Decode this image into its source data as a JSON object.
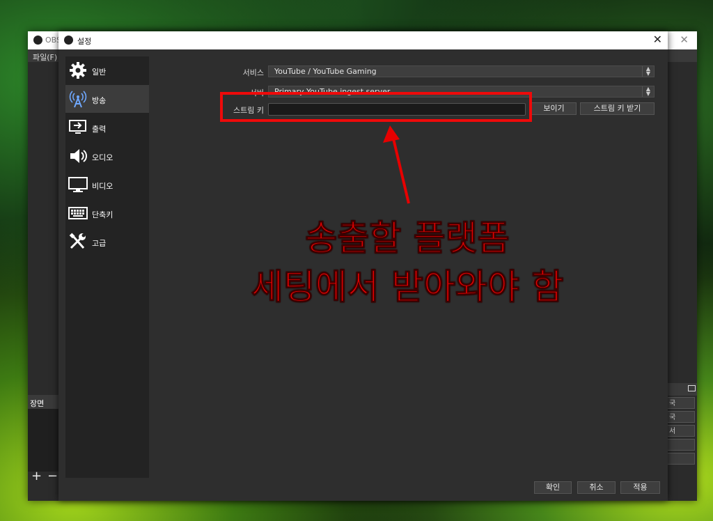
{
  "main_window": {
    "title": "OBS",
    "menu_file": "파일(F)",
    "scenes_label": "장면",
    "add_symbol": "+",
    "remove_symbol": "−",
    "dock_buttons": [
      "국",
      "국",
      "서",
      "",
      ""
    ]
  },
  "settings": {
    "title": "설정",
    "nav": [
      {
        "label": "일반",
        "icon": "gear-icon"
      },
      {
        "label": "방송",
        "icon": "broadcast-antenna-icon"
      },
      {
        "label": "출력",
        "icon": "output-monitor-icon"
      },
      {
        "label": "오디오",
        "icon": "speaker-icon"
      },
      {
        "label": "비디오",
        "icon": "monitor-icon"
      },
      {
        "label": "단축키",
        "icon": "keyboard-icon"
      },
      {
        "label": "고급",
        "icon": "tools-icon"
      }
    ],
    "active_nav": "방송",
    "service_label": "서비스",
    "service_value": "YouTube / YouTube Gaming",
    "server_label": "서버",
    "server_value": "Primary YouTube ingest server",
    "stream_key_label": "스트림 키",
    "stream_key_value": "",
    "show_button": "보이기",
    "get_key_button": "스트림 키 받기",
    "ok_button": "확인",
    "cancel_button": "취소",
    "apply_button": "적용"
  },
  "annotation": {
    "line1": "송출할 플랫폼",
    "line2": "세팅에서 받아와야 함",
    "color": "#e60000"
  }
}
